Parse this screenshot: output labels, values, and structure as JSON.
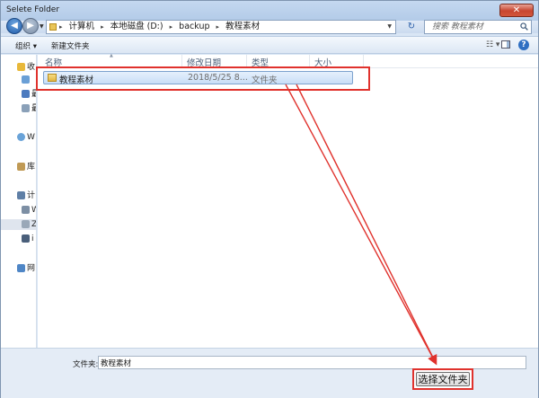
{
  "window": {
    "title": "Selete Folder",
    "close_glyph": "✕"
  },
  "nav": {
    "back_glyph": "◀",
    "forward_glyph": "▶"
  },
  "address": {
    "crumbs": [
      "计算机",
      "本地磁盘 (D:)",
      "backup",
      "教程素材"
    ],
    "separator": "▸",
    "refresh_glyph": "↻"
  },
  "search": {
    "placeholder": "搜索 教程素材"
  },
  "toolbar": {
    "organize_label": "组织 ▾",
    "new_folder_label": "新建文件夹",
    "view_glyph": "☷ ▾",
    "help_label": "?"
  },
  "sidebar": {
    "items": [
      {
        "label": "收",
        "icon": "favorites-star-icon",
        "color": "#e8b83a"
      },
      {
        "label": "",
        "icon": "desktop-icon",
        "color": "#6a9fd6"
      },
      {
        "label": "最",
        "icon": "download-icon",
        "color": "#4d7bbf"
      },
      {
        "label": "最",
        "icon": "recent-places-icon",
        "color": "#8aa0b8"
      },
      {
        "label": "W",
        "icon": "cloud-icon",
        "color": "#6aa3d8"
      },
      {
        "label": "库",
        "icon": "libraries-icon",
        "color": "#c09a55"
      },
      {
        "label": "计",
        "icon": "computer-icon",
        "color": "#5f7fa6"
      },
      {
        "label": "W",
        "icon": "drive-icon",
        "color": "#7d8fa4"
      },
      {
        "label": "Z",
        "icon": "drive-icon",
        "color": "#9aa8b8"
      },
      {
        "label": "i",
        "icon": "drive-icon",
        "color": "#4a5f7a"
      },
      {
        "label": "网",
        "icon": "network-icon",
        "color": "#4f86c6"
      }
    ]
  },
  "list": {
    "columns": [
      "名称",
      "修改日期",
      "类型",
      "大小"
    ],
    "rows": [
      {
        "name": "教程素材",
        "date": "2018/5/25 8...",
        "type": "文件夹",
        "size": ""
      }
    ]
  },
  "bottom": {
    "folder_label": "文件夹:",
    "folder_value": "教程素材",
    "select_button_label": "选择文件夹"
  },
  "colors": {
    "annotation_red": "#e0322d",
    "selection_blue": "#c9def7"
  }
}
